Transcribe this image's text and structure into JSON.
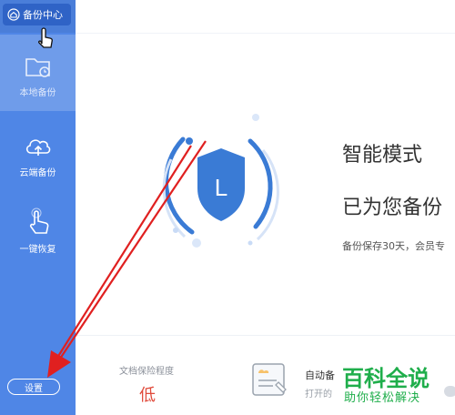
{
  "sidebar": {
    "top_item": {
      "label": "备份中心",
      "icon": "home-icon"
    },
    "items": [
      {
        "label": "本地备份",
        "icon": "folder-clock-icon",
        "active": true
      },
      {
        "label": "云端备份",
        "icon": "cloud-upload-icon",
        "active": false
      },
      {
        "label": "一键恢复",
        "icon": "hand-pointer-icon",
        "active": false
      }
    ],
    "settings_label": "设置"
  },
  "main": {
    "shield_letter": "L",
    "mode_title": "智能模式",
    "backing_title": "已为您备份",
    "keep_text": "备份保存30天，会员专",
    "bottom": {
      "protect_label": "文档保险程度",
      "protect_value": "低",
      "auto_label": "自动备",
      "open_label": "打开的"
    }
  },
  "watermark": {
    "main": "百科全说",
    "sub": "助你轻松解决"
  },
  "colors": {
    "sidebar": "#4f86e6",
    "sidebar_active": "#6f9cea",
    "accent_blue": "#3a7bd5",
    "danger_red": "#e04a3b",
    "watermark_green": "#1fae4b",
    "annotation_red": "#e02020"
  }
}
